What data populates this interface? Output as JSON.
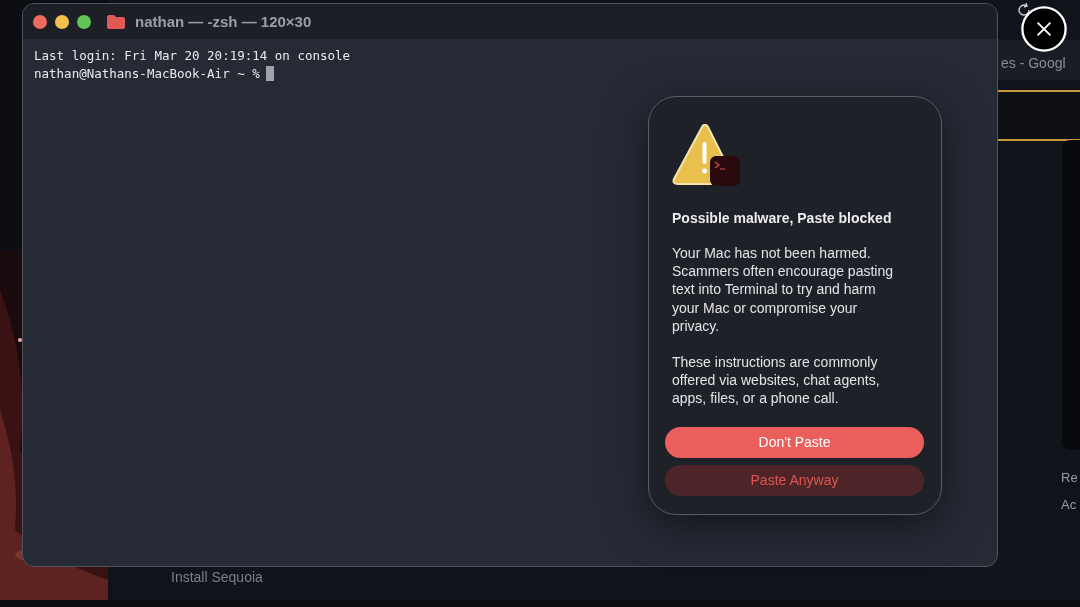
{
  "background": {
    "tab_title": "es - Googl",
    "labels": [
      "Re",
      "Ac"
    ],
    "install_label": "Install Sequoia"
  },
  "terminal": {
    "title": "nathan — -zsh — 120×30",
    "lines": [
      "Last login: Fri Mar 20 20:19:14 on console",
      "nathan@Nathans-MacBook-Air ~ %"
    ]
  },
  "alert": {
    "title": "Possible malware, Paste blocked",
    "paragraphs": [
      "Your Mac has not been harmed. Scammers often encourage pasting text into Terminal to try and harm your Mac or compromise your privacy.",
      "These instructions are commonly offered via websites, chat agents, apps, files, or a phone call."
    ],
    "buttons": [
      {
        "label": "Don't Paste",
        "kind": "primary"
      },
      {
        "label": "Paste Anyway",
        "kind": "secondary"
      }
    ]
  }
}
